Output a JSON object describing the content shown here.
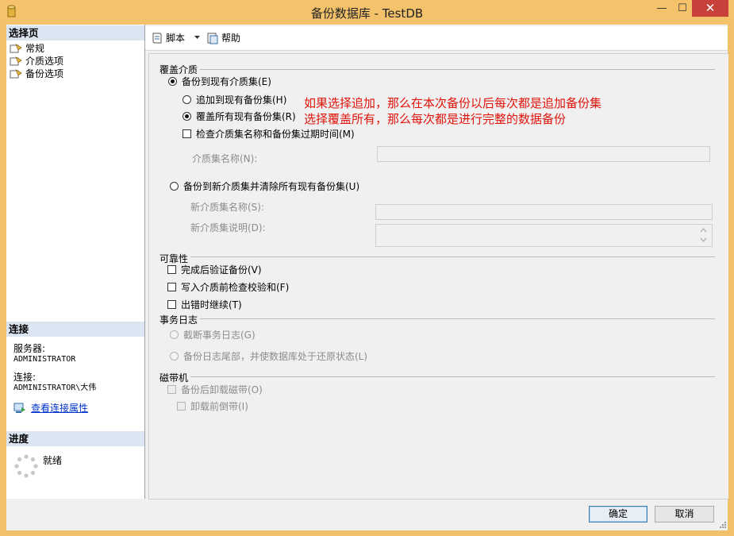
{
  "window": {
    "title": "备份数据库 - TestDB",
    "min_glyph": "—",
    "max_glyph": "☐",
    "close_glyph": "✕"
  },
  "left": {
    "select_page_header": "选择页",
    "pages": [
      {
        "label": "常规",
        "icon": "page-icon"
      },
      {
        "label": "介质选项",
        "icon": "page-icon"
      },
      {
        "label": "备份选项",
        "icon": "page-icon"
      }
    ],
    "connection_header": "连接",
    "server_label": "服务器:",
    "server_value": "ADMINISTRATOR",
    "conn_label": "连接:",
    "conn_value": "ADMINISTRATOR\\大伟",
    "view_props_link": "查看连接属性",
    "progress_header": "进度",
    "progress_status": "就绪"
  },
  "toolbar": {
    "script_label": "脚本",
    "help_label": "帮助"
  },
  "overwrite_media": {
    "group_label": "覆盖介质",
    "backup_existing": "备份到现有介质集(E)",
    "append": "追加到现有备份集(H)",
    "overwrite_all": "覆盖所有现有备份集(R)",
    "check_expiry": "检查介质集名称和备份集过期时间(M)",
    "media_set_name_label": "介质集名称(N):",
    "backup_new": "备份到新介质集并清除所有现有备份集(U)",
    "new_media_set_name_label": "新介质集名称(S):",
    "new_media_set_desc_label": "新介质集说明(D):"
  },
  "annotation": {
    "line1": "如果选择追加，那么在本次备份以后每次都是追加备份集",
    "line2": "选择覆盖所有，那么每次都是进行完整的数据备份",
    "color": "#e0140c"
  },
  "reliability": {
    "group_label": "可靠性",
    "verify": "完成后验证备份(V)",
    "checksum": "写入介质前检查校验和(F)",
    "continue_on_error": "出错时继续(T)"
  },
  "transaction_log": {
    "group_label": "事务日志",
    "truncate": "截断事务日志(G)",
    "tail_log": "备份日志尾部，并使数据库处于还原状态(L)"
  },
  "tape": {
    "group_label": "磁带机",
    "unload": "备份后卸载磁带(O)",
    "rewind": "卸载前倒带(I)"
  },
  "footer": {
    "ok_label": "确定",
    "cancel_label": "取消"
  }
}
